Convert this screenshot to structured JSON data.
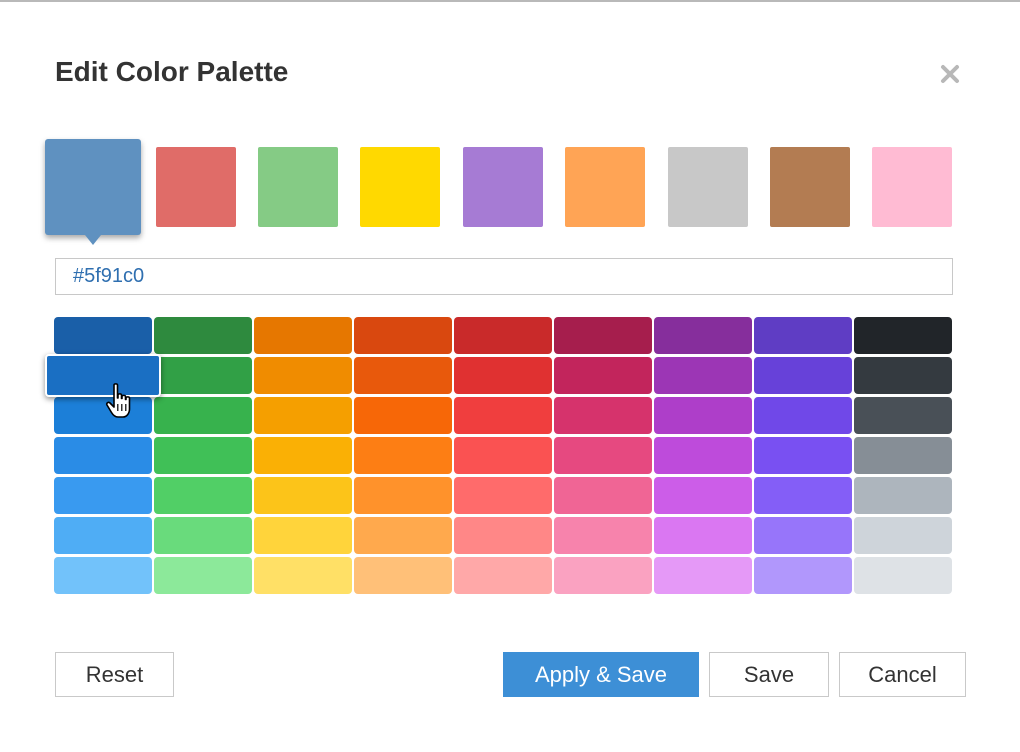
{
  "dialog": {
    "title": "Edit Color Palette",
    "close_icon": "close-icon"
  },
  "palette": {
    "swatches": [
      "#5f91c0",
      "#e06c68",
      "#85cb85",
      "#ffd900",
      "#a67bd4",
      "#ffa455",
      "#c8c8c8",
      "#b37c52",
      "#ffbbd3"
    ],
    "selected_index": 0
  },
  "hex_input": {
    "value": "#5f91c0"
  },
  "color_grid": {
    "columns": [
      [
        "#1a5fa8",
        "#1a6fc3",
        "#1c7fd8",
        "#2a8ce6",
        "#399af0",
        "#4fadf5",
        "#72c2fa"
      ],
      [
        "#2e8a3e",
        "#31a046",
        "#37b24d",
        "#40c057",
        "#51cf66",
        "#69db7c",
        "#8ce99a"
      ],
      [
        "#e67700",
        "#f08c00",
        "#f59f00",
        "#fab005",
        "#fcc419",
        "#ffd43b",
        "#ffe066"
      ],
      [
        "#d9480f",
        "#e8590c",
        "#f76707",
        "#fd7e14",
        "#ff922b",
        "#ffa94d",
        "#ffc078"
      ],
      [
        "#c92a2a",
        "#e03131",
        "#f03e3e",
        "#fa5252",
        "#ff6b6b",
        "#ff8787",
        "#ffa8a8"
      ],
      [
        "#a61e4d",
        "#c2255c",
        "#d6336c",
        "#e64980",
        "#f06595",
        "#f783ac",
        "#faa2c1"
      ],
      [
        "#862e9c",
        "#9c36b5",
        "#ae3ec9",
        "#be4bdb",
        "#cc5de8",
        "#da77f2",
        "#e599f7"
      ],
      [
        "#5f3dc4",
        "#6741d9",
        "#7048e8",
        "#7950f2",
        "#845ef7",
        "#9775fa",
        "#b197fc"
      ],
      [
        "#212529",
        "#343a40",
        "#495057",
        "#868e96",
        "#adb5bd",
        "#ced4da",
        "#dee2e6"
      ]
    ],
    "hovered": {
      "column": 0,
      "row": 1
    }
  },
  "buttons": {
    "reset": "Reset",
    "apply_save": "Apply & Save",
    "save": "Save",
    "cancel": "Cancel"
  },
  "cursor_icon": "hand-pointer-icon"
}
